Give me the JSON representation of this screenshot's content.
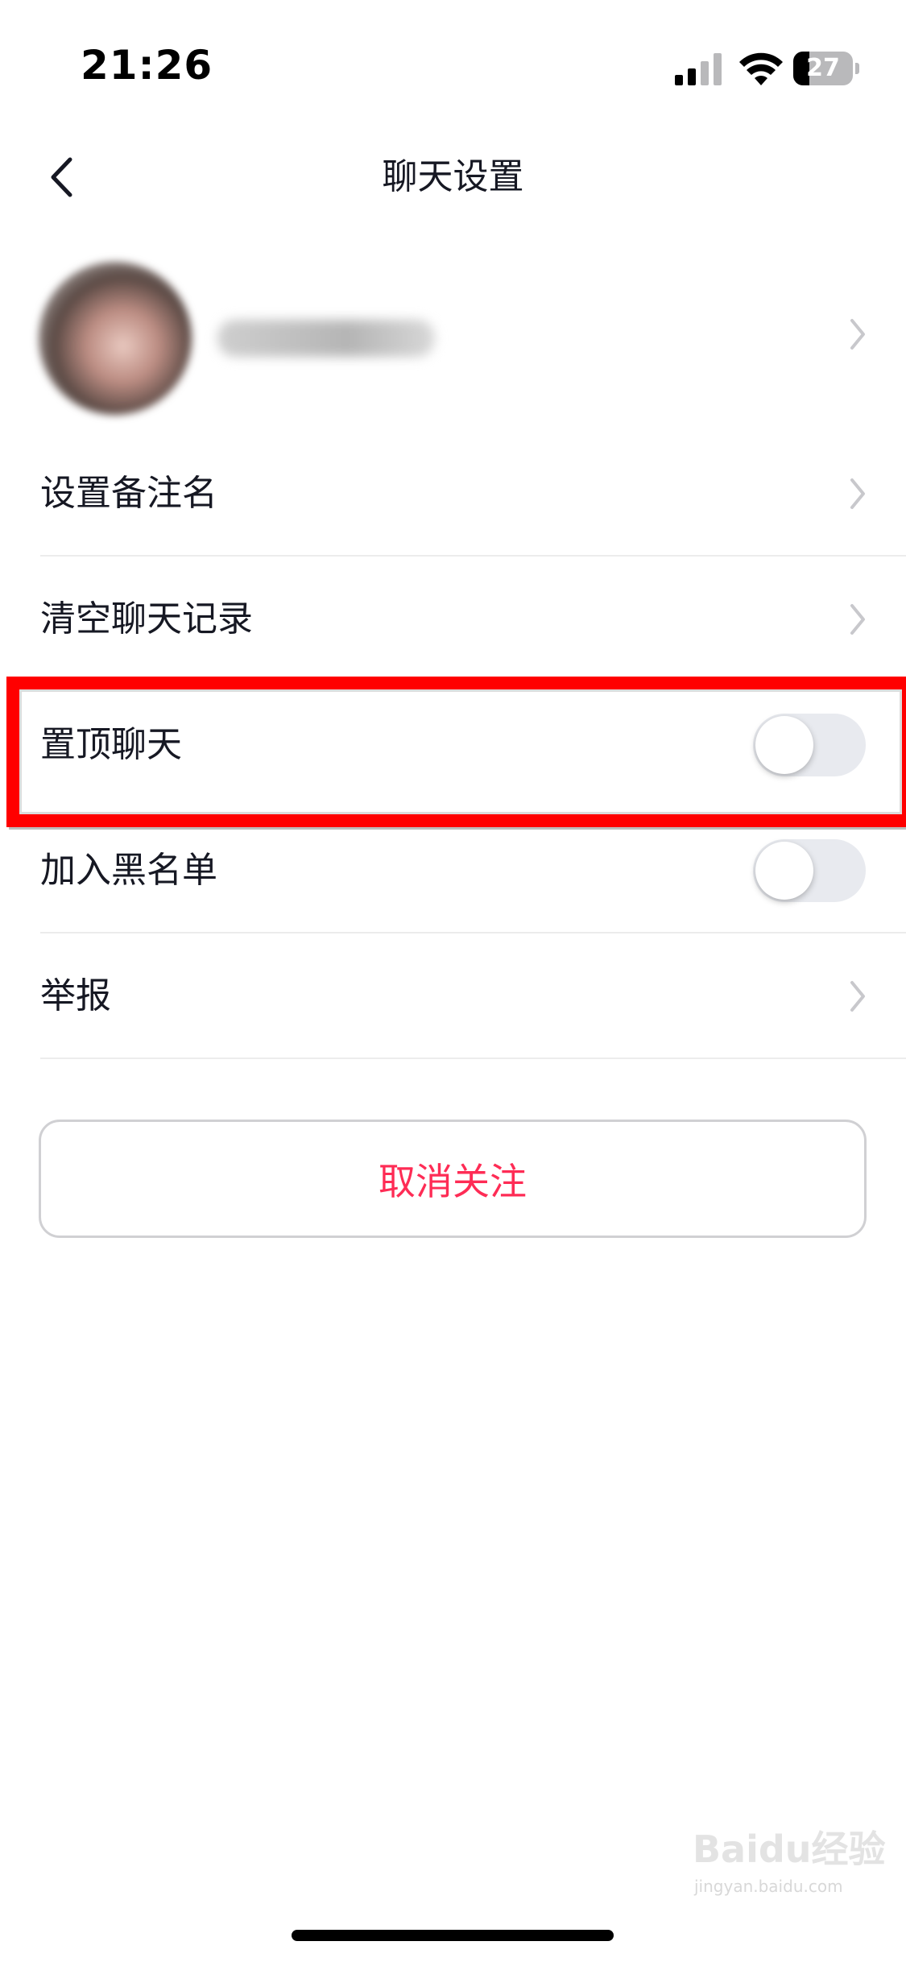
{
  "status_bar": {
    "time": "21:26",
    "battery": "27",
    "battery_level": 0.27,
    "icons": [
      "signal-icon",
      "wifi-icon",
      "battery-icon"
    ]
  },
  "nav": {
    "title": "聊天设置",
    "back_icon": "chevron-left-icon"
  },
  "profile": {
    "name": "",
    "avatar_blurred": true,
    "chevron_icon": "chevron-right-icon"
  },
  "settings": {
    "remark": {
      "label": "设置备注名"
    },
    "clear_history": {
      "label": "清空聊天记录"
    },
    "pin_chat": {
      "label": "置顶聊天",
      "on": false
    },
    "blacklist": {
      "label": "加入黑名单",
      "on": false
    },
    "report": {
      "label": "举报"
    }
  },
  "actions": {
    "unfollow_label": "取消关注"
  },
  "watermark": {
    "text": "Baidu经验",
    "sub": "jingyan.baidu.com"
  },
  "colors": {
    "highlight": "#ff0000",
    "danger": "#fe2c55",
    "toggle_off": "#e8eaef",
    "divider": "#ececec"
  }
}
